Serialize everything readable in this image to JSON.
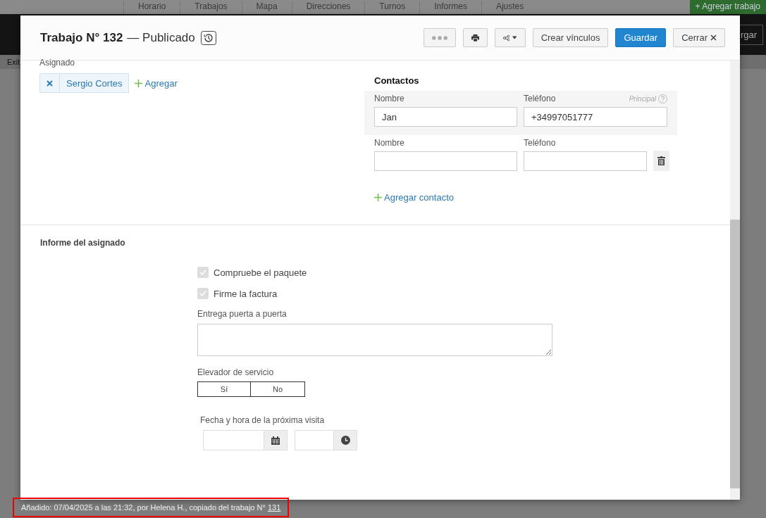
{
  "background": {
    "tabs": [
      "Horario",
      "Trabajos",
      "Mapa",
      "Direcciones",
      "Turnos",
      "Informes",
      "Ajustes"
    ],
    "add_button": "+ Agregar trabajo",
    "side_button": "rgar",
    "filter_label": "Exit"
  },
  "window": {
    "title": "Trabajo N° 132",
    "status": "— Publicado"
  },
  "toolbar": {
    "links_button": "Crear vínculos",
    "save_button": "Guardar",
    "close_button": "Cerrar"
  },
  "assigned": {
    "label": "Asignado",
    "people": [
      {
        "name": "Sergio Cortes"
      }
    ],
    "add": "Agregar"
  },
  "contacts": {
    "title": "Contactos",
    "principal_label": "Principal",
    "add": "Agregar contacto",
    "rows": [
      {
        "name_label": "Nombre",
        "phone_label": "Teléfono",
        "name": "Jan",
        "phone": "+34997051777",
        "principal": true
      },
      {
        "name_label": "Nombre",
        "phone_label": "Teléfono",
        "principal": false
      }
    ]
  },
  "report": {
    "title": "Informe del asignado",
    "fields": [
      {
        "kind": "checkbox",
        "label": "Compruebe el paquete",
        "checked": true,
        "disabled": true
      },
      {
        "kind": "checkbox",
        "label": "Firme la factura",
        "checked": true,
        "disabled": true
      },
      {
        "kind": "textarea",
        "label": "Entrega puerta a puerta"
      },
      {
        "kind": "toggle",
        "label": "Elevador de servicio",
        "options": [
          {
            "label": "Sí",
            "selected": false
          },
          {
            "label": "No",
            "selected": false
          }
        ]
      },
      {
        "kind": "datetime",
        "label": "Fecha y hora de la próxima visita"
      }
    ]
  },
  "footer": {
    "text": "Añadido: 07/04/2025 a las 21:32, por Helena H., copiado del trabajo N°",
    "link": "131"
  }
}
